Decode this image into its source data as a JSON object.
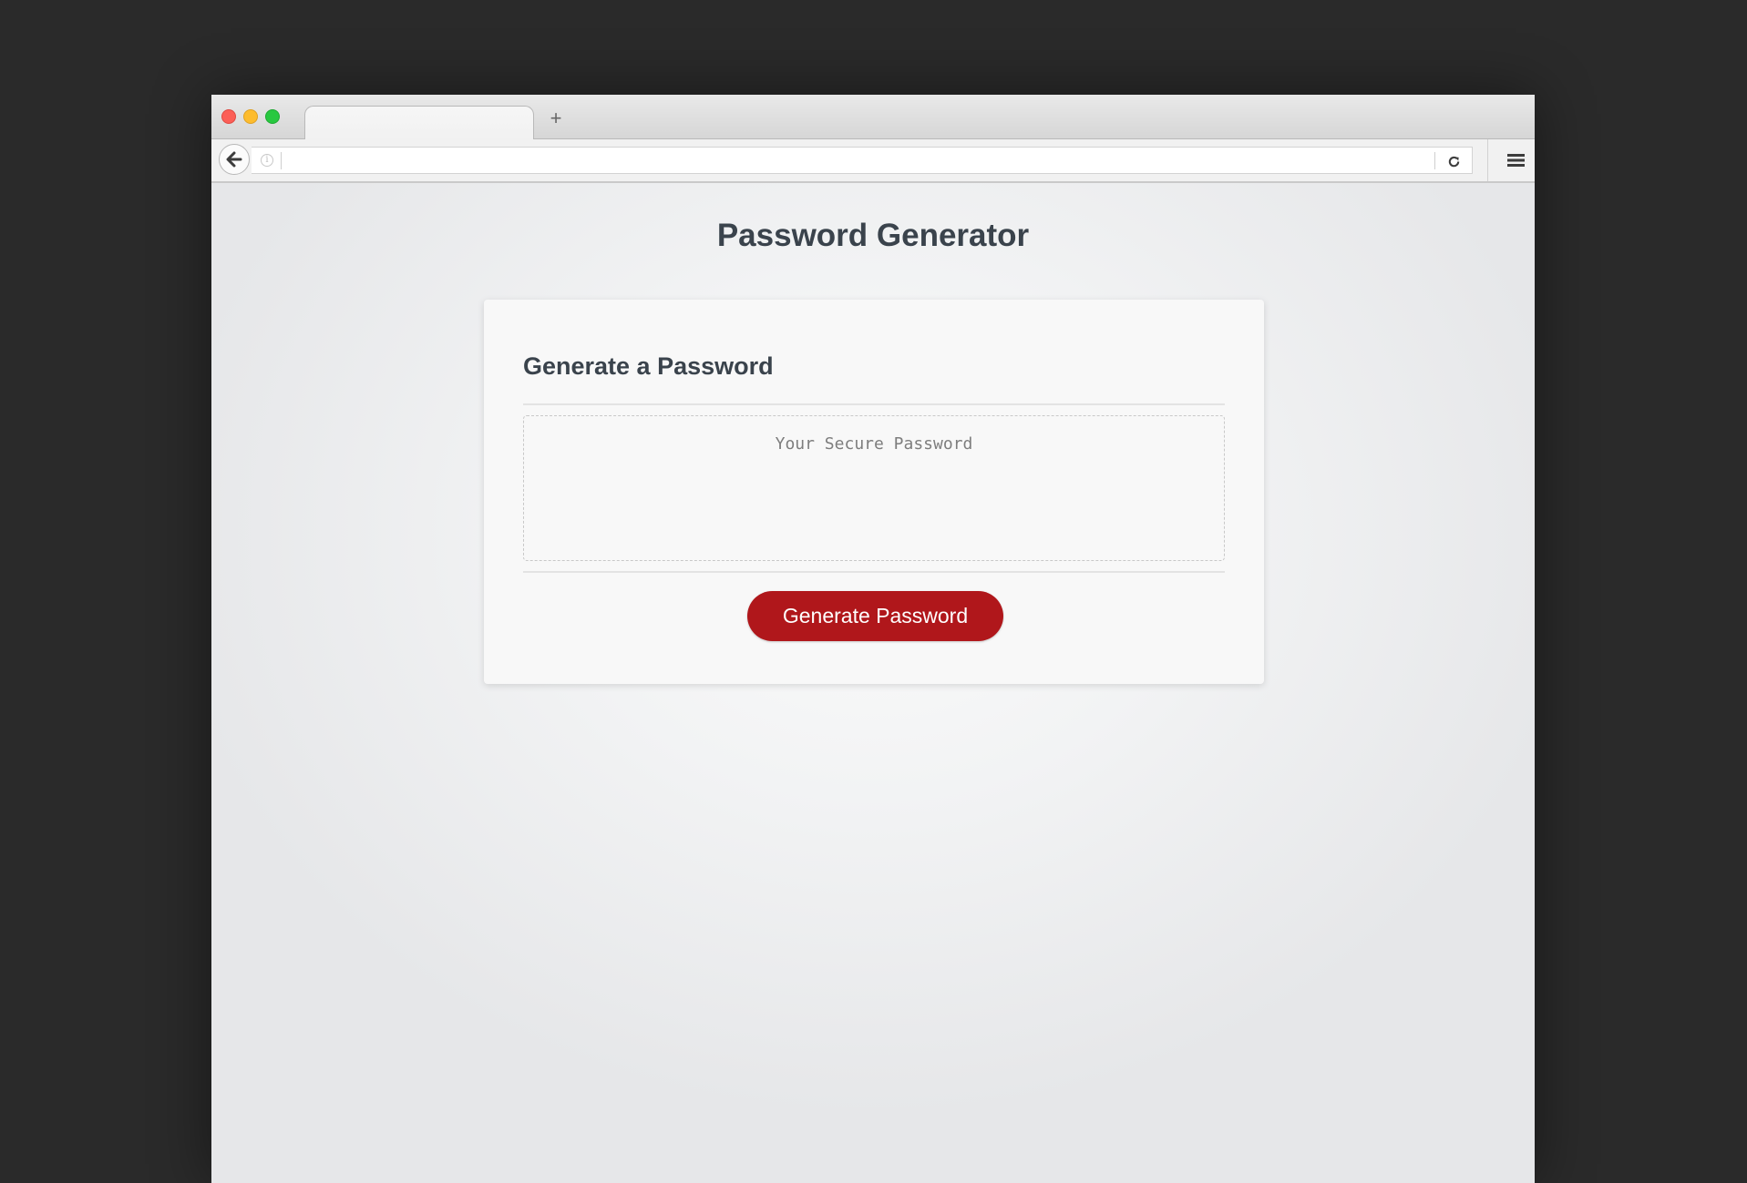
{
  "page": {
    "title": "Password Generator"
  },
  "card": {
    "header": "Generate a Password",
    "password_placeholder": "Your Secure Password",
    "password_value": "",
    "generate_button_label": "Generate Password"
  },
  "browser": {
    "new_tab_symbol": "+",
    "url": "",
    "icons": {
      "back": "arrow-left-icon",
      "info": "info-icon",
      "reload": "reload-icon",
      "menu": "hamburger-menu-icon"
    }
  },
  "colors": {
    "accent_button": "#b0171b",
    "heading_text": "#3a434c",
    "backdrop": "#2a2a2a"
  }
}
